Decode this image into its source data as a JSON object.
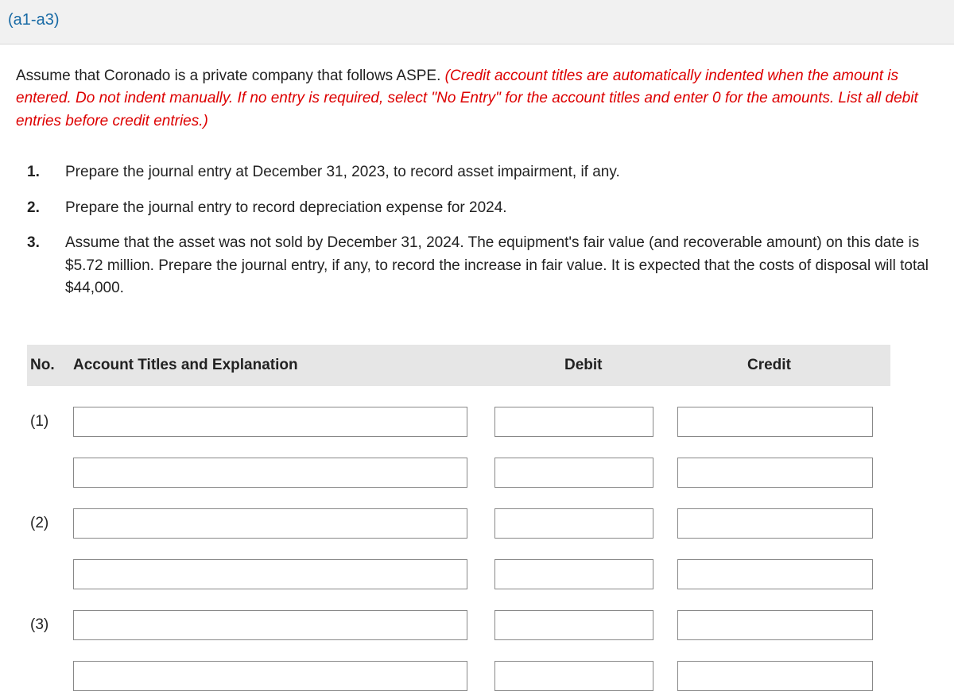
{
  "header": {
    "link": "(a1-a3)"
  },
  "intro": {
    "plain": "Assume that Coronado is a private company that follows ASPE. ",
    "red": "(Credit account titles are automatically indented when the amount is entered. Do not indent manually. If no entry is required, select \"No Entry\" for the account titles and enter 0 for the amounts. List all debit entries before credit entries.)"
  },
  "items": [
    {
      "num": "1.",
      "text": "Prepare the journal entry at December 31, 2023, to record asset impairment, if any."
    },
    {
      "num": "2.",
      "text": "Prepare the journal entry to record depreciation expense for 2024."
    },
    {
      "num": "3.",
      "text": "Assume that the asset was not sold by December 31, 2024. The equipment's fair value (and recoverable amount) on this date is $5.72 million. Prepare the journal entry, if any, to record the increase in fair value. It is expected that the costs of disposal will total $44,000."
    }
  ],
  "tableHeaders": {
    "no": "No.",
    "acct": "Account Titles and Explanation",
    "debit": "Debit",
    "credit": "Credit"
  },
  "rows": [
    {
      "no": "(1)"
    },
    {
      "no": ""
    },
    {
      "no": "(2)"
    },
    {
      "no": ""
    },
    {
      "no": "(3)"
    },
    {
      "no": ""
    }
  ]
}
